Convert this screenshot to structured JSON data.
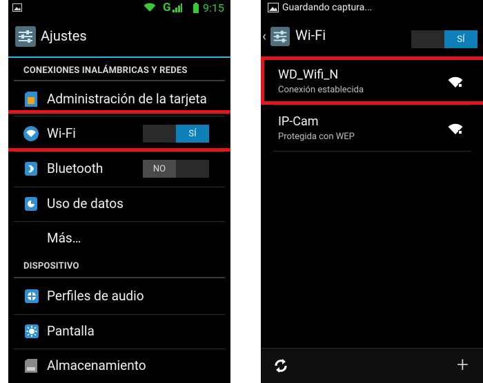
{
  "left": {
    "status": {
      "network": "G",
      "time": "9:15"
    },
    "title": "Ajustes",
    "sections": {
      "wireless": "CONEXIONES INALÁMBRICAS Y REDES",
      "device": "DISPOSITIVO"
    },
    "items": {
      "sim": "Administración de la tarjeta",
      "wifi": "Wi-Fi",
      "bluetooth": "Bluetooth",
      "data_usage": "Uso de datos",
      "more": "Más…",
      "audio": "Perfiles de audio",
      "display": "Pantalla",
      "storage": "Almacenamiento"
    },
    "toggles": {
      "wifi_on": "SÍ",
      "bluetooth_off": "NO"
    }
  },
  "right": {
    "notification": "Guardando captura...",
    "title": "Wi-Fi",
    "toggle_on": "SÍ",
    "networks": [
      {
        "name": "WD_Wifi_N",
        "status": "Conexión establecida"
      },
      {
        "name": "IP-Cam",
        "status": "Protegida con WEP"
      }
    ]
  },
  "colors": {
    "accent": "#33b5e5",
    "highlight": "#e3141b",
    "toggle_on": "#0e7fb8"
  }
}
